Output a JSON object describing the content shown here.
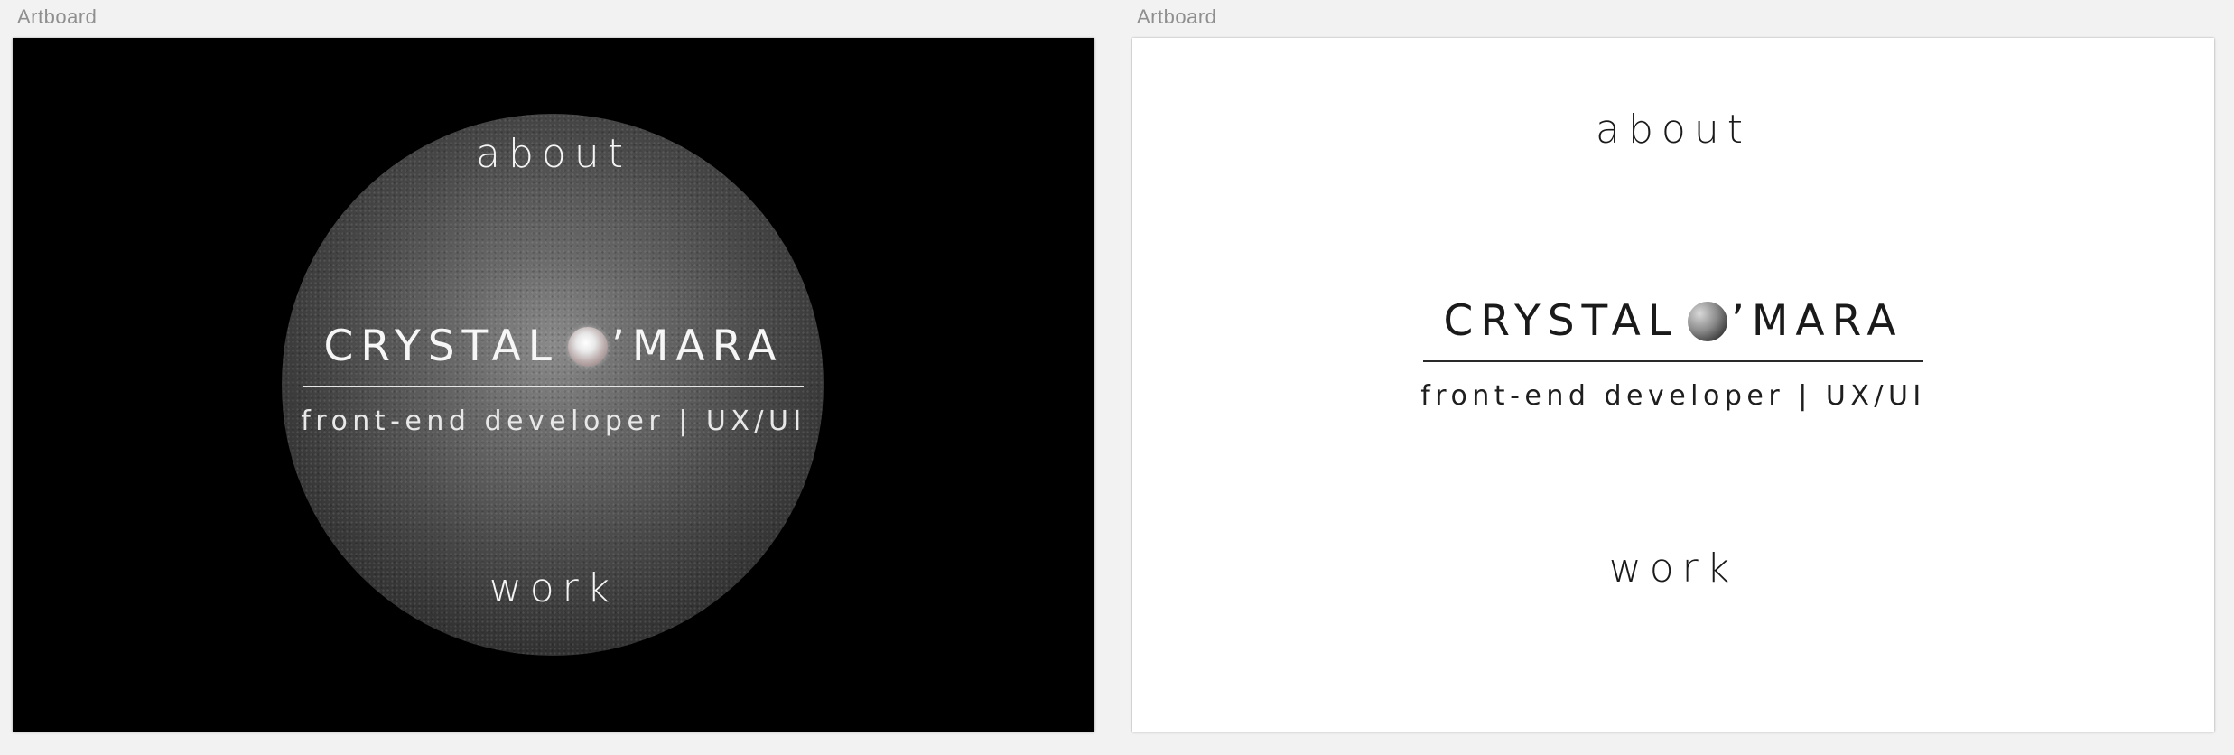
{
  "artboards": [
    {
      "label": "Artboard",
      "theme": "dark",
      "background": "#000000",
      "nav_about": "about",
      "brand_left": "CRYSTAL",
      "brand_right": "’MARA",
      "tagline": "front-end developer | UX/UI",
      "nav_work": "work"
    },
    {
      "label": "Artboard",
      "theme": "light",
      "background": "#ffffff",
      "nav_about": "about",
      "brand_left": "CRYSTAL",
      "brand_right": "’MARA",
      "tagline": "front-end developer | UX/UI",
      "nav_work": "work"
    }
  ],
  "colors": {
    "canvas_bg": "#f2f2f2",
    "label_gray": "#8f8f8f"
  }
}
